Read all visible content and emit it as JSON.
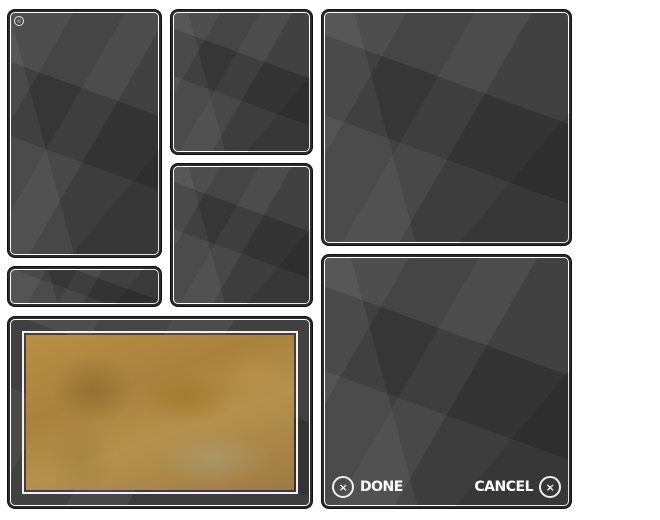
{
  "actions": {
    "done_label": "DONE",
    "cancel_label": "CANCEL",
    "done_icon_glyph": "×",
    "cancel_icon_glyph": "×"
  },
  "icons": {
    "selected_indicator": "radio-icon",
    "done": "close-circle-icon",
    "cancel": "close-circle-icon"
  },
  "colors": {
    "panel_background": "#3b3b3b",
    "panel_border": "#ffffff",
    "photo_tone": "#b88f45",
    "label_text": "#ffffff"
  }
}
